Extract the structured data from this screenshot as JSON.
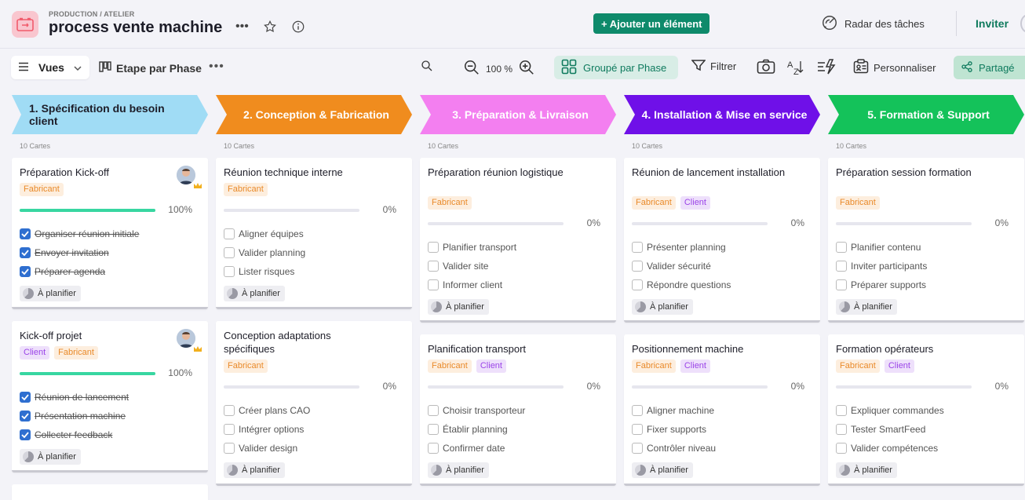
{
  "header": {
    "breadcrumb": "PRODUCTION / ATELIER",
    "title": "process vente machine",
    "add_button": "+ Ajouter un élément",
    "radar_label": "Radar des tâches",
    "invite_label": "Inviter"
  },
  "toolbar": {
    "views_label": "Vues",
    "view_name": "Etape par Phase",
    "zoom_level": "100 %",
    "group_label": "Groupé par Phase",
    "filter_label": "Filtrer",
    "customize_label": "Personnaliser",
    "share_label": "Partagé"
  },
  "tag_labels": {
    "fabricant": "Fabricant",
    "client": "Client"
  },
  "colors": {
    "phase1": "#a0dcf5",
    "phase2": "#f08c1e",
    "phase3": "#f37ff0",
    "phase4": "#6f10e8",
    "phase5": "#14c25a",
    "accent": "#0e8a6b"
  },
  "columns": [
    {
      "title": "1. Spécification du besoin client",
      "count": "10 Cartes",
      "cards": [
        {
          "title": "Préparation Kick-off",
          "tags": [
            "Fabricant"
          ],
          "progress": "100%",
          "status": "À planifier",
          "checklist": [
            {
              "label": "Organiser réunion initiale",
              "done": true
            },
            {
              "label": "Envoyer invitation",
              "done": true
            },
            {
              "label": "Préparer agenda",
              "done": true
            }
          ]
        },
        {
          "title": "Kick-off projet",
          "tags": [
            "Client",
            "Fabricant"
          ],
          "progress": "100%",
          "status": "À planifier",
          "checklist": [
            {
              "label": "Réunion de lancement",
              "done": true
            },
            {
              "label": "Présentation machine",
              "done": true
            },
            {
              "label": "Collecter feedback",
              "done": true
            }
          ]
        }
      ]
    },
    {
      "title": "2. Conception & Fabrication",
      "count": "10 Cartes",
      "cards": [
        {
          "title": "Réunion technique interne",
          "tags": [
            "Fabricant"
          ],
          "progress": "0%",
          "status": "À planifier",
          "checklist": [
            {
              "label": "Aligner équipes",
              "done": false
            },
            {
              "label": "Valider planning",
              "done": false
            },
            {
              "label": "Lister risques",
              "done": false
            }
          ]
        },
        {
          "title": "Conception adaptations spécifiques",
          "tags": [
            "Fabricant"
          ],
          "progress": "0%",
          "status": "À planifier",
          "checklist": [
            {
              "label": "Créer plans CAO",
              "done": false
            },
            {
              "label": "Intégrer options",
              "done": false
            },
            {
              "label": "Valider design",
              "done": false
            }
          ]
        }
      ]
    },
    {
      "title": "3. Préparation & Livraison",
      "count": "10 Cartes",
      "cards": [
        {
          "title": "Préparation réunion logistique",
          "tags": [
            "Fabricant"
          ],
          "progress": "0%",
          "status": "À planifier",
          "checklist": [
            {
              "label": "Planifier transport",
              "done": false
            },
            {
              "label": "Valider site",
              "done": false
            },
            {
              "label": "Informer client",
              "done": false
            }
          ]
        },
        {
          "title": "Planification transport",
          "tags": [
            "Fabricant",
            "Client"
          ],
          "progress": "0%",
          "status": "À planifier",
          "checklist": [
            {
              "label": "Choisir transporteur",
              "done": false
            },
            {
              "label": "Établir planning",
              "done": false
            },
            {
              "label": "Confirmer date",
              "done": false
            }
          ]
        }
      ]
    },
    {
      "title": "4. Installation & Mise en service",
      "count": "10 Cartes",
      "cards": [
        {
          "title": "Réunion de lancement installation",
          "tags": [
            "Fabricant",
            "Client"
          ],
          "progress": "0%",
          "status": "À planifier",
          "checklist": [
            {
              "label": "Présenter planning",
              "done": false
            },
            {
              "label": "Valider sécurité",
              "done": false
            },
            {
              "label": "Répondre questions",
              "done": false
            }
          ]
        },
        {
          "title": "Positionnement machine",
          "tags": [
            "Fabricant",
            "Client"
          ],
          "progress": "0%",
          "status": "À planifier",
          "checklist": [
            {
              "label": "Aligner machine",
              "done": false
            },
            {
              "label": "Fixer supports",
              "done": false
            },
            {
              "label": "Contrôler niveau",
              "done": false
            }
          ]
        }
      ]
    },
    {
      "title": "5. Formation & Support",
      "count": "10 Cartes",
      "cards": [
        {
          "title": "Préparation session formation",
          "tags": [
            "Fabricant"
          ],
          "progress": "0%",
          "status": "À planifier",
          "checklist": [
            {
              "label": "Planifier contenu",
              "done": false
            },
            {
              "label": "Inviter participants",
              "done": false
            },
            {
              "label": "Préparer supports",
              "done": false
            }
          ]
        },
        {
          "title": "Formation opérateurs",
          "tags": [
            "Fabricant",
            "Client"
          ],
          "progress": "0%",
          "status": "À planifier",
          "checklist": [
            {
              "label": "Expliquer commandes",
              "done": false
            },
            {
              "label": "Tester SmartFeed",
              "done": false
            },
            {
              "label": "Valider compétences",
              "done": false
            }
          ]
        }
      ]
    }
  ]
}
